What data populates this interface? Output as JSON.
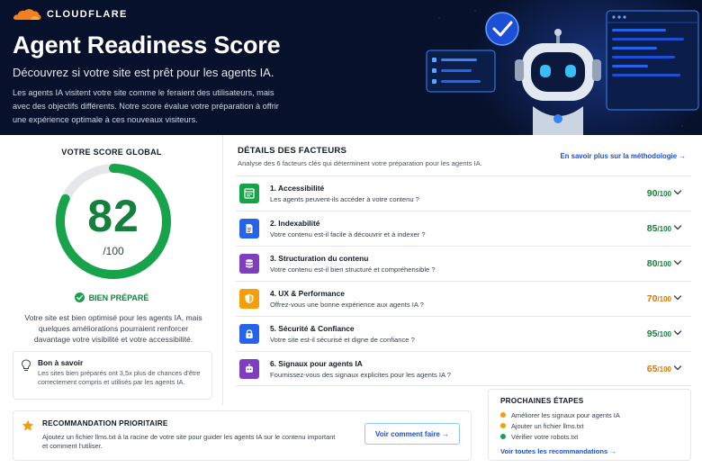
{
  "brand": {
    "name": "CLOUDFLARE",
    "icon": "cloudflare-cloud-icon",
    "color": "#f38020"
  },
  "hero": {
    "title": "Agent Readiness Score",
    "subtitle": "Découvrez si votre site est prêt pour les agents IA.",
    "description": "Les agents IA visitent votre site comme le feraient des utilisateurs, mais avec des objectifs différents. Notre score évalue votre préparation à offrir une expérience optimale à ces nouveaux visiteurs."
  },
  "score": {
    "title": "VOTRE SCORE GLOBAL",
    "value": "82",
    "denominator": "/100",
    "fraction": 0.82,
    "status": "BIEN PRÉPARÉ",
    "description": "Votre site est bien optimisé pour les agents IA, mais quelques améliorations pourraient renforcer davantage votre visibilité et votre accessibilité.",
    "tip": {
      "title": "Bon à savoir",
      "text": "Les sites bien préparés ont 3,5x plus de chances d'être correctement compris et utilisés par les agents IA."
    }
  },
  "factors": {
    "title": "DÉTAILS DES FACTEURS",
    "subtitle": "Analyse des 6 facteurs clés qui déterminent votre préparation pour les agents IA.",
    "methodology_link": "En savoir plus sur la méthodologie →",
    "items": [
      {
        "name": "1. Accessibilité",
        "question": "Les agents peuvent-ils accéder à votre contenu ?",
        "score": "90",
        "den": "/100",
        "color": "#15803d",
        "icon_bg": "#16a34a",
        "icon": "grid-window-icon"
      },
      {
        "name": "2. Indexabilité",
        "question": "Votre contenu est-il facile à découvrir et à indexer ?",
        "score": "85",
        "den": "/100",
        "color": "#15803d",
        "icon_bg": "#2563eb",
        "icon": "document-icon"
      },
      {
        "name": "3. Structuration du contenu",
        "question": "Votre contenu est-il bien structuré et compréhensible ?",
        "score": "80",
        "den": "/100",
        "color": "#15803d",
        "icon_bg": "#7e3fbf",
        "icon": "database-icon"
      },
      {
        "name": "4. UX & Performance",
        "question": "Offrez-vous une bonne expérience aux agents IA ?",
        "score": "70",
        "den": "/100",
        "color": "#d97706",
        "icon_bg": "#f59e0b",
        "icon": "shield-icon"
      },
      {
        "name": "5. Sécurité & Confiance",
        "question": "Votre site est-il sécurisé et digne de confiance ?",
        "score": "95",
        "den": "/100",
        "color": "#15803d",
        "icon_bg": "#2563eb",
        "icon": "lock-icon"
      },
      {
        "name": "6. Signaux pour agents IA",
        "question": "Fournissez-vous des signaux explicites pour les agents IA ?",
        "score": "65",
        "den": "/100",
        "color": "#d97706",
        "icon_bg": "#7e3fbf",
        "icon": "robot-icon"
      }
    ]
  },
  "recommendation": {
    "title": "RECOMMANDATION PRIORITAIRE",
    "text": "Ajoutez un fichier llms.txt à la racine de votre site pour guider les agents IA sur le contenu important et comment l'utiliser.",
    "button": "Voir comment faire →"
  },
  "next_steps": {
    "title": "PROCHAINES ÉTAPES",
    "items": [
      {
        "label": "Améliorer les signaux pour agents IA",
        "color": "#f59e0b"
      },
      {
        "label": "Ajouter un fichier llms.txt",
        "color": "#f59e0b"
      },
      {
        "label": "Vérifier votre robots.txt",
        "color": "#16a34a"
      }
    ],
    "link": "Voir toutes les recommandations →"
  }
}
